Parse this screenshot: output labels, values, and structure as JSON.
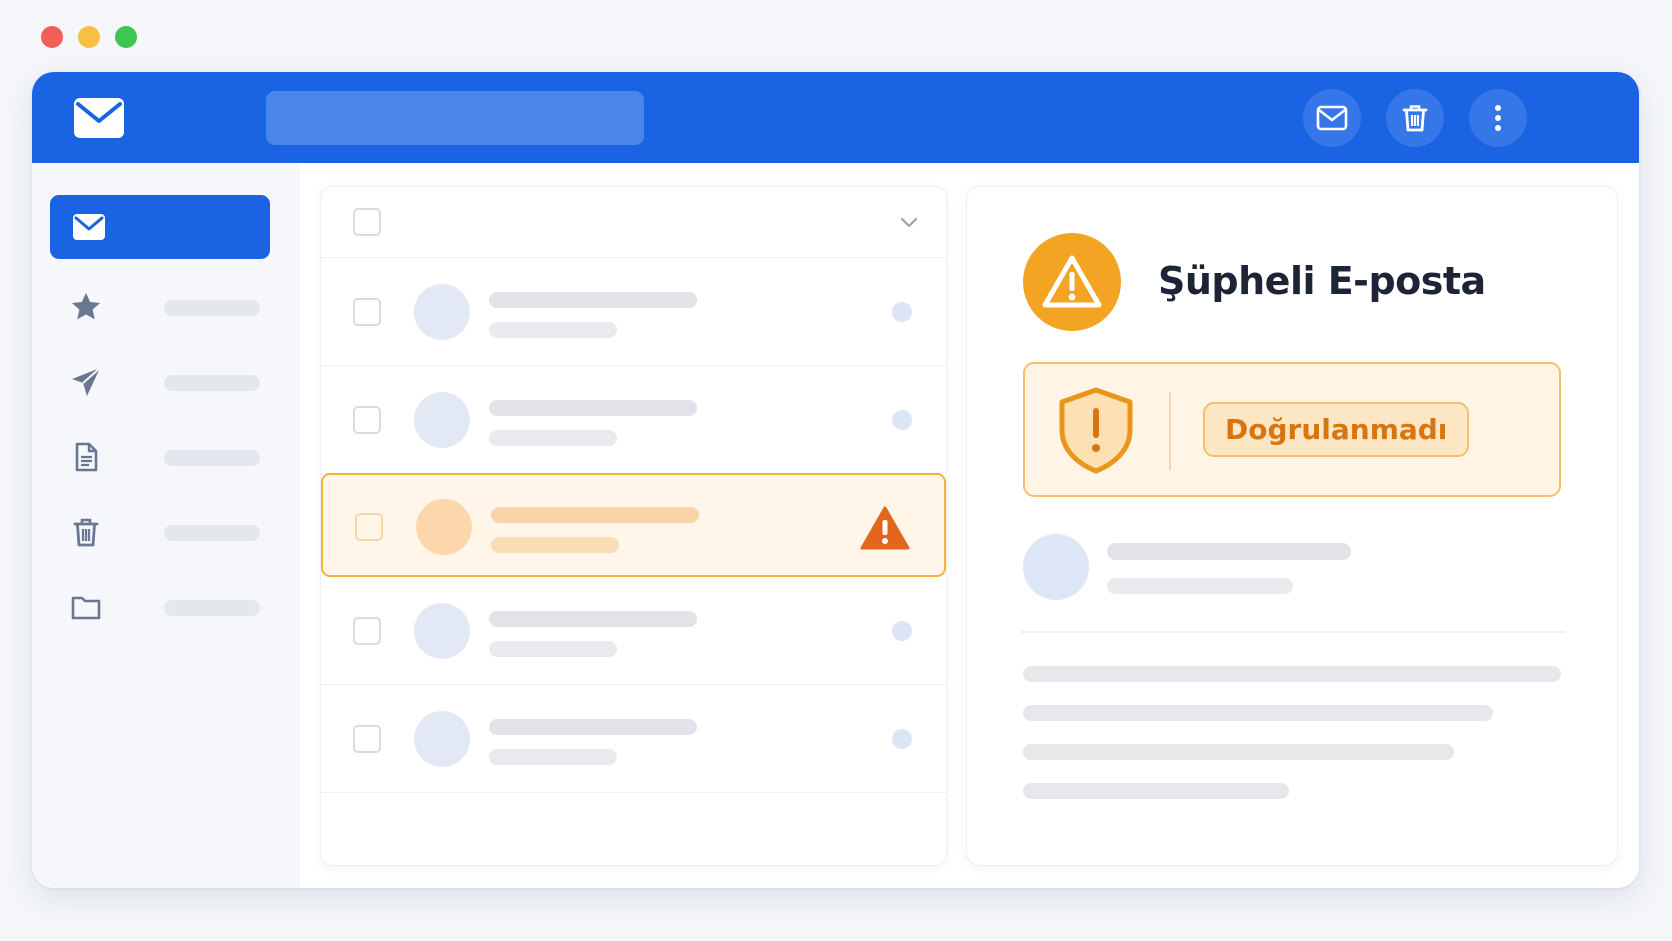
{
  "window": {
    "controls": {
      "close_color": "#f25f58",
      "minimize_color": "#f8c042",
      "zoom_color": "#3ec552"
    }
  },
  "toolbar": {
    "logo_icon": "mail-icon",
    "search": {
      "value": "",
      "placeholder": ""
    },
    "actions": [
      {
        "name": "mail-action",
        "icon": "mail-outline-icon"
      },
      {
        "name": "delete-action",
        "icon": "trash-icon"
      },
      {
        "name": "more-action",
        "icon": "more-vertical-icon"
      }
    ]
  },
  "sidebar": {
    "items": [
      {
        "icon": "mail-icon",
        "label": "",
        "active": true
      },
      {
        "icon": "star-icon",
        "label": ""
      },
      {
        "icon": "send-icon",
        "label": ""
      },
      {
        "icon": "document-icon",
        "label": ""
      },
      {
        "icon": "trash-icon",
        "label": ""
      },
      {
        "icon": "folder-icon",
        "label": ""
      }
    ]
  },
  "message_list": {
    "header": {
      "select_all_checked": false,
      "menu_icon": "chevron-down-icon"
    },
    "rows": [
      {
        "status": "unread",
        "flagged": false
      },
      {
        "status": "unread",
        "flagged": false
      },
      {
        "status": "suspicious",
        "flagged": true,
        "icon": "warning-icon"
      },
      {
        "status": "unread",
        "flagged": false
      },
      {
        "status": "unread",
        "flagged": false
      }
    ]
  },
  "detail": {
    "icon": "warning-icon",
    "title": "Şüpheli E-posta",
    "alert": {
      "icon": "shield-alert-icon",
      "badge": "Doğrulanmadı"
    }
  },
  "colors": {
    "accent": "#1a64e3",
    "warning": "#f4a423",
    "warning_dark": "#e4661c",
    "badge_text": "#d77611"
  }
}
